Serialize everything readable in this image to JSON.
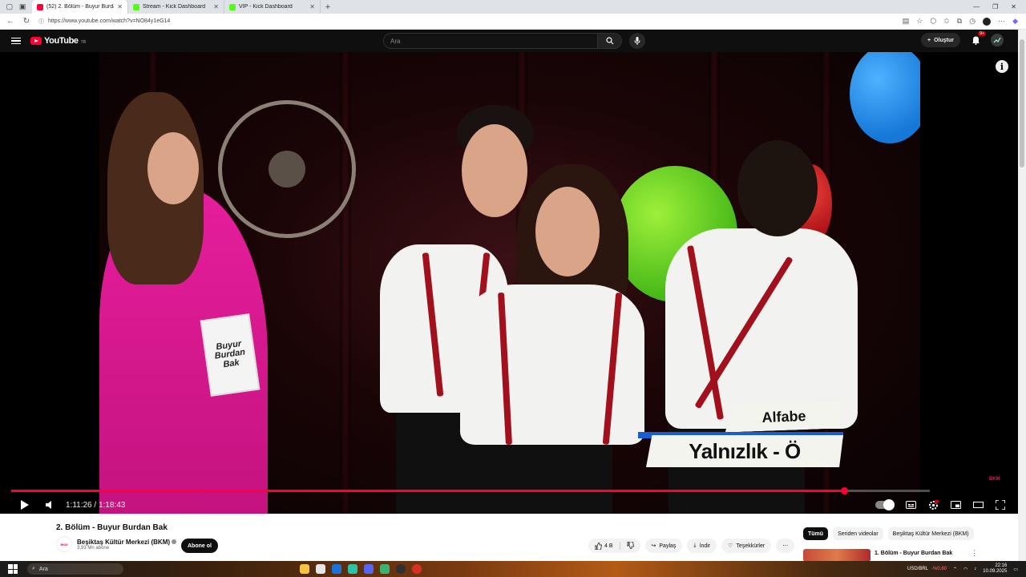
{
  "browser": {
    "tabs": [
      {
        "label": "(52) 2. Bölüm - Buyur Burdan Bak",
        "color": "#ff0033",
        "active": true
      },
      {
        "label": "Stream - Kick Dashboard",
        "color": "#53fc18",
        "active": false
      },
      {
        "label": "VIP - Kick Dashboard",
        "color": "#53fc18",
        "active": false
      }
    ],
    "url": "https://www.youtube.com/watch?v=NO84y1eG14"
  },
  "youtube": {
    "logo_text": "YouTube",
    "country_code": "TR",
    "search_placeholder": "Ara",
    "create_label": "Oluştur",
    "notification_count": "9+"
  },
  "player": {
    "current_time": "1:11:26",
    "separator": " / ",
    "duration": "1:18:43",
    "progress_fraction": 0.907,
    "caption_top": "Alfabe",
    "caption_main": "Yalnızlık - Ö",
    "book_text": "Buyur Burdan Bak",
    "watermark": "BKM"
  },
  "video": {
    "title": "2. Bölüm - Buyur Burdan Bak",
    "channel_name": "Beşiktaş Kültür Merkezi (BKM)",
    "subscribers": "3,93 Mn abone",
    "channel_logo_text": "BKM",
    "subscribe_label": "Abone ol",
    "like_count": "4 B",
    "share_label": "Paylaş",
    "download_label": "İndir",
    "thanks_label": "Teşekkürler"
  },
  "sidebar": {
    "chips": [
      {
        "label": "Tümü",
        "selected": true
      },
      {
        "label": "Seriden videolar",
        "selected": false
      },
      {
        "label": "Beşiktaş Kültür Merkezi (BKM)",
        "selected": false
      }
    ],
    "recommendation_title": "1. Bölüm - Buyur Burdan Bak"
  },
  "taskbar": {
    "search_label": "Ara",
    "ticker_label": "USD/BRL",
    "ticker_change": "-%0,60",
    "time": "22:16",
    "date": "10.09.2025"
  },
  "colors": {
    "youtube_red": "#ff0033",
    "player_bg": "#000000",
    "page_bg": "#0f0f0f"
  }
}
